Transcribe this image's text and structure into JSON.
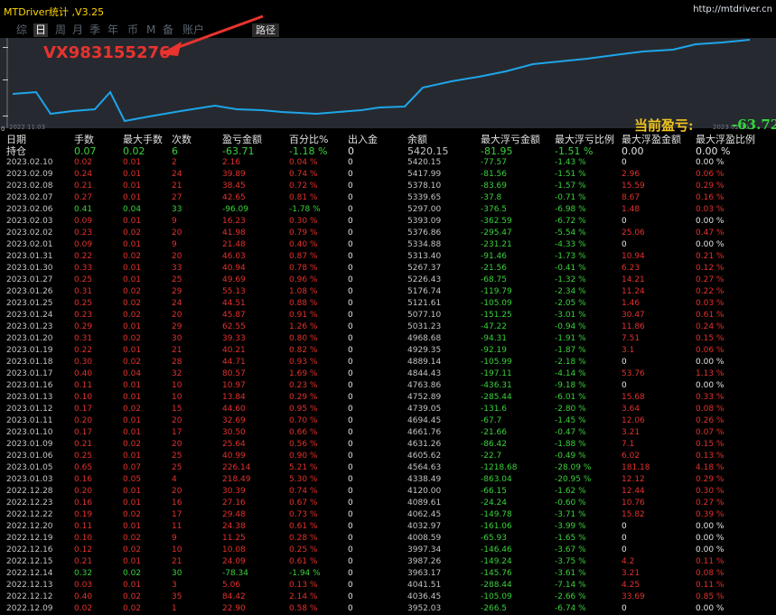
{
  "title": "MTDriver统计 ,V3.25",
  "url": "http://mtdriver.cn",
  "periods": [
    "综",
    "日",
    "周",
    "月",
    "季",
    "年",
    "币",
    "M",
    "备",
    "账户"
  ],
  "active_period": "日",
  "route_button": "路径",
  "watermark": "VX983155276",
  "chart_start_date": "2022.11.03",
  "chart_end_date": "2023.02.10",
  "axis_label": "0",
  "profit_label": "当前盈亏:",
  "profit_value": "-63.72",
  "headers": [
    "日期",
    "手数",
    "最大手数",
    "次数",
    "盈亏金额",
    "百分比%",
    "出入金",
    "余额",
    "最大浮亏金额",
    "最大浮亏比例",
    "最大浮盈金额",
    "最大浮盈比例"
  ],
  "hold": {
    "label": "持仓",
    "lots": "0.07",
    "max_lots": "0.02",
    "count": "6",
    "pnl": "-63.71",
    "pct": "-1.18 %",
    "inout": "0",
    "balance": "5420.15",
    "max_float_loss": "-81.95",
    "max_float_loss_pct": "-1.51 %",
    "max_float_profit": "0.00",
    "max_float_profit_pct": "0.00 %"
  },
  "rows": [
    [
      "2023.02.10",
      "0.02",
      "0.01",
      "2",
      "2.16",
      "0.04 %",
      "0",
      "5420.15",
      "-77.57",
      "-1.43 %",
      "0",
      "0.00 %"
    ],
    [
      "2023.02.09",
      "0.24",
      "0.01",
      "24",
      "39.89",
      "0.74 %",
      "0",
      "5417.99",
      "-81.56",
      "-1.51 %",
      "2.96",
      "0.06 %"
    ],
    [
      "2023.02.08",
      "0.21",
      "0.01",
      "21",
      "38.45",
      "0.72 %",
      "0",
      "5378.10",
      "-83.69",
      "-1.57 %",
      "15.59",
      "0.29 %"
    ],
    [
      "2023.02.07",
      "0.27",
      "0.01",
      "27",
      "42.65",
      "0.81 %",
      "0",
      "5339.65",
      "-37.8",
      "-0.71 %",
      "8.67",
      "0.16 %"
    ],
    [
      "2023.02.06",
      "0.41",
      "0.04",
      "33",
      "-96.09",
      "-1.78 %",
      "0",
      "5297.00",
      "-376.5",
      "-6.98 %",
      "1.48",
      "0.03 %"
    ],
    [
      "2023.02.03",
      "0.09",
      "0.01",
      "9",
      "16.23",
      "0.30 %",
      "0",
      "5393.09",
      "-362.59",
      "-6.72 %",
      "0",
      "0.00 %"
    ],
    [
      "2023.02.02",
      "0.23",
      "0.02",
      "20",
      "41.98",
      "0.79 %",
      "0",
      "5376.86",
      "-295.47",
      "-5.54 %",
      "25.06",
      "0.47 %"
    ],
    [
      "2023.02.01",
      "0.09",
      "0.01",
      "9",
      "21.48",
      "0.40 %",
      "0",
      "5334.88",
      "-231.21",
      "-4.33 %",
      "0",
      "0.00 %"
    ],
    [
      "2023.01.31",
      "0.22",
      "0.02",
      "20",
      "46.03",
      "0.87 %",
      "0",
      "5313.40",
      "-91.46",
      "-1.73 %",
      "10.94",
      "0.21 %"
    ],
    [
      "2023.01.30",
      "0.33",
      "0.01",
      "33",
      "40.94",
      "0.78 %",
      "0",
      "5267.37",
      "-21.56",
      "-0.41 %",
      "6.23",
      "0.12 %"
    ],
    [
      "2023.01.27",
      "0.25",
      "0.01",
      "25",
      "49.69",
      "0.96 %",
      "0",
      "5226.43",
      "-68.75",
      "-1.32 %",
      "14.21",
      "0.27 %"
    ],
    [
      "2023.01.26",
      "0.31",
      "0.02",
      "29",
      "55.13",
      "1.08 %",
      "0",
      "5176.74",
      "-119.79",
      "-2.34 %",
      "11.24",
      "0.22 %"
    ],
    [
      "2023.01.25",
      "0.25",
      "0.02",
      "24",
      "44.51",
      "0.88 %",
      "0",
      "5121.61",
      "-105.09",
      "-2.05 %",
      "1.46",
      "0.03 %"
    ],
    [
      "2023.01.24",
      "0.23",
      "0.02",
      "20",
      "45.87",
      "0.91 %",
      "0",
      "5077.10",
      "-151.25",
      "-3.01 %",
      "30.47",
      "0.61 %"
    ],
    [
      "2023.01.23",
      "0.29",
      "0.01",
      "29",
      "62.55",
      "1.26 %",
      "0",
      "5031.23",
      "-47.22",
      "-0.94 %",
      "11.86",
      "0.24 %"
    ],
    [
      "2023.01.20",
      "0.31",
      "0.02",
      "30",
      "39.33",
      "0.80 %",
      "0",
      "4968.68",
      "-94.31",
      "-1.91 %",
      "7.51",
      "0.15 %"
    ],
    [
      "2023.01.19",
      "0.22",
      "0.01",
      "21",
      "40.21",
      "0.82 %",
      "0",
      "4929.35",
      "-92.19",
      "-1.87 %",
      "3.1",
      "0.06 %"
    ],
    [
      "2023.01.18",
      "0.30",
      "0.02",
      "28",
      "44.71",
      "0.93 %",
      "0",
      "4889.14",
      "-105.99",
      "-2.18 %",
      "0",
      "0.00 %"
    ],
    [
      "2023.01.17",
      "0.40",
      "0.04",
      "32",
      "80.57",
      "1.69 %",
      "0",
      "4844.43",
      "-197.11",
      "-4.14 %",
      "53.76",
      "1.13 %"
    ],
    [
      "2023.01.16",
      "0.11",
      "0.01",
      "10",
      "10.97",
      "0.23 %",
      "0",
      "4763.86",
      "-436.31",
      "-9.18 %",
      "0",
      "0.00 %"
    ],
    [
      "2023.01.13",
      "0.10",
      "0.01",
      "10",
      "13.84",
      "0.29 %",
      "0",
      "4752.89",
      "-285.44",
      "-6.01 %",
      "15.68",
      "0.33 %"
    ],
    [
      "2023.01.12",
      "0.17",
      "0.02",
      "15",
      "44.60",
      "0.95 %",
      "0",
      "4739.05",
      "-131.6",
      "-2.80 %",
      "3.64",
      "0.08 %"
    ],
    [
      "2023.01.11",
      "0.20",
      "0.01",
      "20",
      "32.69",
      "0.70 %",
      "0",
      "4694.45",
      "-67.7",
      "-1.45 %",
      "12.06",
      "0.26 %"
    ],
    [
      "2023.01.10",
      "0.17",
      "0.01",
      "17",
      "30.50",
      "0.66 %",
      "0",
      "4661.76",
      "-21.66",
      "-0.47 %",
      "3.21",
      "0.07 %"
    ],
    [
      "2023.01.09",
      "0.21",
      "0.02",
      "20",
      "25.64",
      "0.56 %",
      "0",
      "4631.26",
      "-86.42",
      "-1.88 %",
      "7.1",
      "0.15 %"
    ],
    [
      "2023.01.06",
      "0.25",
      "0.01",
      "25",
      "40.99",
      "0.90 %",
      "0",
      "4605.62",
      "-22.7",
      "-0.49 %",
      "6.02",
      "0.13 %"
    ],
    [
      "2023.01.05",
      "0.65",
      "0.07",
      "25",
      "226.14",
      "5.21 %",
      "0",
      "4564.63",
      "-1218.68",
      "-28.09 %",
      "181.18",
      "4.18 %"
    ],
    [
      "2023.01.03",
      "0.16",
      "0.05",
      "4",
      "218.49",
      "5.30 %",
      "0",
      "4338.49",
      "-863.04",
      "-20.95 %",
      "12.12",
      "0.29 %"
    ],
    [
      "2022.12.28",
      "0.20",
      "0.01",
      "20",
      "30.39",
      "0.74 %",
      "0",
      "4120.00",
      "-66.15",
      "-1.62 %",
      "12.44",
      "0.30 %"
    ],
    [
      "2022.12.23",
      "0.16",
      "0.01",
      "16",
      "27.16",
      "0.67 %",
      "0",
      "4089.61",
      "-24.24",
      "-0.60 %",
      "10.76",
      "0.27 %"
    ],
    [
      "2022.12.22",
      "0.19",
      "0.02",
      "17",
      "29.48",
      "0.73 %",
      "0",
      "4062.45",
      "-149.78",
      "-3.71 %",
      "15.82",
      "0.39 %"
    ],
    [
      "2022.12.20",
      "0.11",
      "0.01",
      "11",
      "24.38",
      "0.61 %",
      "0",
      "4032.97",
      "-161.06",
      "-3.99 %",
      "0",
      "0.00 %"
    ],
    [
      "2022.12.19",
      "0.10",
      "0.02",
      "9",
      "11.25",
      "0.28 %",
      "0",
      "4008.59",
      "-65.93",
      "-1.65 %",
      "0",
      "0.00 %"
    ],
    [
      "2022.12.16",
      "0.12",
      "0.02",
      "10",
      "10.08",
      "0.25 %",
      "0",
      "3997.34",
      "-146.46",
      "-3.67 %",
      "0",
      "0.00 %"
    ],
    [
      "2022.12.15",
      "0.21",
      "0.01",
      "21",
      "24.09",
      "0.61 %",
      "0",
      "3987.26",
      "-149.24",
      "-3.75 %",
      "4.2",
      "0.11 %"
    ],
    [
      "2022.12.14",
      "0.32",
      "0.02",
      "30",
      "-78.34",
      "-1.94 %",
      "0",
      "3963.17",
      "-145.76",
      "-3.61 %",
      "3.21",
      "0.08 %"
    ],
    [
      "2022.12.13",
      "0.03",
      "0.01",
      "3",
      "5.06",
      "0.13 %",
      "0",
      "4041.51",
      "-288.44",
      "-7.14 %",
      "4.25",
      "0.11 %"
    ],
    [
      "2022.12.12",
      "0.40",
      "0.02",
      "35",
      "84.42",
      "2.14 %",
      "0",
      "4036.45",
      "-105.09",
      "-2.66 %",
      "33.69",
      "0.85 %"
    ],
    [
      "2022.12.09",
      "0.02",
      "0.02",
      "1",
      "22.90",
      "0.58 %",
      "0",
      "3952.03",
      "-266.5",
      "-6.74 %",
      "0",
      "0.00 %"
    ]
  ],
  "colors": {
    "background": "#000000",
    "chart_bg": "#262a30",
    "line": "#1ea5ea",
    "profit": "#e3312c",
    "loss": "#3ad13a",
    "title": "#ffd400"
  }
}
